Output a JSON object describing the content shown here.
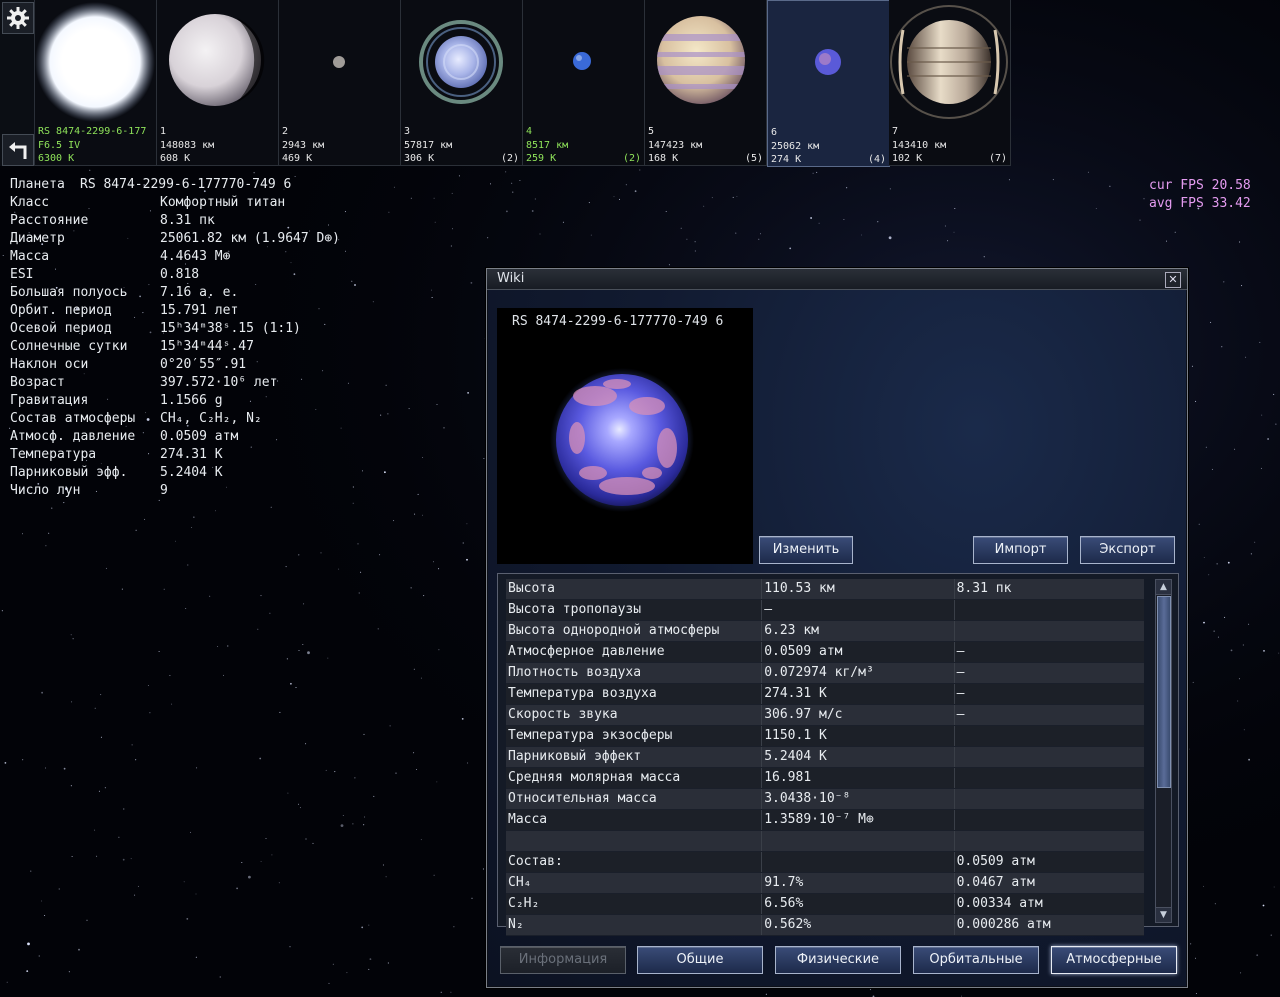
{
  "top_strip": {
    "tiles": [
      {
        "name_line": "RS 8474-2299-6-177",
        "line2": "F6.5 IV",
        "line3": "6300 K",
        "moons": "",
        "variant": "star"
      },
      {
        "name_line": "1",
        "line2": "148083 км",
        "line3": "608 K",
        "moons": "",
        "variant": "white"
      },
      {
        "name_line": "2",
        "line2": "2943 км",
        "line3": "469 K",
        "moons": "",
        "variant": "tiny"
      },
      {
        "name_line": "3",
        "line2": "57817 км",
        "line3": "306 K",
        "moons": "(2)",
        "variant": "ringed"
      },
      {
        "name_line": "4",
        "line2": "8517 км",
        "line3": "259 K",
        "moons": "(2)",
        "variant": "bluedot"
      },
      {
        "name_line": "5",
        "line2": "147423 км",
        "line3": "168 K",
        "moons": "(5)",
        "variant": "gas"
      },
      {
        "name_line": "6",
        "line2": "25062 км",
        "line3": "274 K",
        "moons": "(4)",
        "variant": "small-blue"
      },
      {
        "name_line": "7",
        "line2": "143410 км",
        "line3": "102 K",
        "moons": "(7)",
        "variant": "saturn"
      }
    ]
  },
  "planet_info": {
    "header_label": "Планета",
    "header_value": "RS 8474-2299-6-177770-749 6",
    "rows": [
      {
        "label": "Класс",
        "value": "Комфортный титан"
      },
      {
        "label": "Расстояние",
        "value": "8.31 пк"
      },
      {
        "label": "Диаметр",
        "value": "25061.82 км (1.9647 D⊕)"
      },
      {
        "label": "Масса",
        "value": "4.4643 M⊕"
      },
      {
        "label": "ESI",
        "value": "0.818"
      },
      {
        "label": "Большая полуось",
        "value": "7.16 а. е."
      },
      {
        "label": "Орбит. период",
        "value": "15.791 лет"
      },
      {
        "label": "Осевой период",
        "value": "15ʰ34ᵐ38ˢ.15 (1:1)"
      },
      {
        "label": "Солнечные сутки",
        "value": "15ʰ34ᵐ44ˢ.47"
      },
      {
        "label": "Наклон оси",
        "value": "0°20′55″.91"
      },
      {
        "label": "Возраст",
        "value": "397.572·10⁶ лет"
      },
      {
        "label": "Гравитация",
        "value": "1.1566 g"
      },
      {
        "label": "Состав атмосферы",
        "value": "CH₄, C₂H₂, N₂"
      },
      {
        "label": "Атмосф. давление",
        "value": "0.0509 атм"
      },
      {
        "label": "Температура",
        "value": "274.31 K"
      },
      {
        "label": "Парниковый эфф.",
        "value": "5.2404 K"
      },
      {
        "label": "Число лун",
        "value": "9"
      }
    ]
  },
  "fps": {
    "cur": "cur FPS 20.58",
    "avg": "avg FPS 33.42"
  },
  "wiki": {
    "title": "Wiki",
    "close": "✕",
    "preview_title": "RS 8474-2299-6-177770-749 6",
    "buttons": {
      "edit": "Изменить",
      "import": "Импорт",
      "export": "Экспорт"
    },
    "table": [
      [
        "Высота",
        "110.53 км",
        "8.31 пк"
      ],
      [
        "Высота тропопаузы",
        "–",
        ""
      ],
      [
        "Высота однородной атмосферы",
        "6.23 км",
        ""
      ],
      [
        "Атмосферное давление",
        "0.0509 атм",
        "–"
      ],
      [
        "Плотность воздуха",
        "0.072974 кг/м³",
        "–"
      ],
      [
        "Температура воздуха",
        "274.31 K",
        "–"
      ],
      [
        "Скорость звука",
        "306.97 м/с",
        "–"
      ],
      [
        "Температура экзосферы",
        "1150.1 K",
        ""
      ],
      [
        "Парниковый эффект",
        "5.2404 K",
        ""
      ],
      [
        "Средняя молярная масса",
        "16.981",
        ""
      ],
      [
        "Относительная масса",
        "3.0438·10⁻⁸",
        ""
      ],
      [
        "Масса",
        "1.3589·10⁻⁷ M⊕",
        ""
      ],
      [
        "",
        "",
        ""
      ],
      [
        "Состав:",
        "",
        "0.0509 атм"
      ],
      [
        "CH₄",
        "91.7%",
        "0.0467 атм"
      ],
      [
        "C₂H₂",
        "6.56%",
        "0.00334 атм"
      ],
      [
        "N₂",
        "0.562%",
        "0.000286 атм"
      ]
    ],
    "tabs": [
      {
        "label": "Информация",
        "state": "disabled"
      },
      {
        "label": "Общие",
        "state": "normal"
      },
      {
        "label": "Физические",
        "state": "normal"
      },
      {
        "label": "Орбитальные",
        "state": "normal"
      },
      {
        "label": "Атмосферные",
        "state": "active"
      }
    ]
  },
  "icons": {
    "settings": "gear-icon",
    "back": "back-arrow-icon",
    "close": "close-icon"
  },
  "colors": {
    "fps": "#e49bf0",
    "selected_green": "#8fe35a",
    "button_top": "#3a4c78"
  }
}
